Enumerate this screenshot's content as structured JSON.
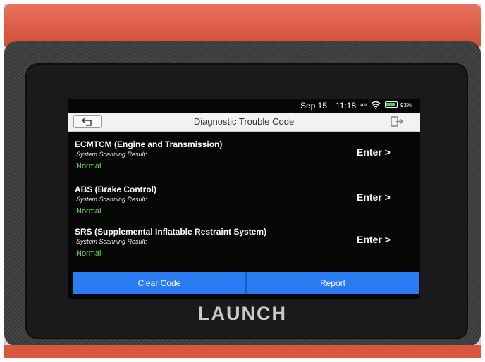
{
  "status": {
    "date": "Sep 15",
    "time": "11:18",
    "ampm": "AM",
    "battery": "93%",
    "battery_level": 0.93
  },
  "header": {
    "title": "Diagnostic Trouble Code",
    "back_icon": "back-arrow-icon",
    "exit_icon": "exit-icon"
  },
  "systems": [
    {
      "name": "ECMTCM (Engine and Transmission)",
      "sub": "System Scanning Result:",
      "result": "Normal",
      "action": "Enter >"
    },
    {
      "name": "ABS (Brake Control)",
      "sub": "System Scanning Result:",
      "result": "Normal",
      "action": "Enter >"
    },
    {
      "name": "SRS (Supplemental Inflatable Restraint System)",
      "sub": "System Scanning Result:",
      "result": "Normal",
      "action": "Enter >"
    }
  ],
  "footer": {
    "clear_code": "Clear Code",
    "report": "Report"
  },
  "brand": "LAUNCH",
  "colors": {
    "accent": "#2a7cf2",
    "normal": "#6fd65a",
    "battery": "#41d24a",
    "case": "#d9573f"
  }
}
